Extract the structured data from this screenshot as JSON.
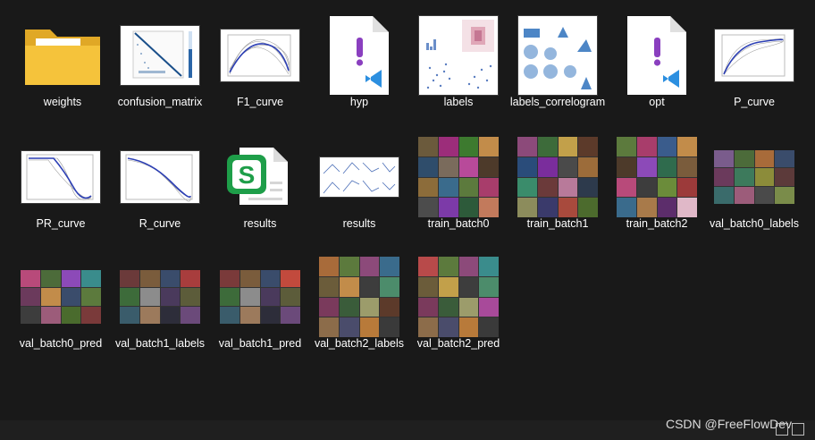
{
  "files": [
    {
      "name": "weights",
      "type": "folder"
    },
    {
      "name": "confusion_matrix",
      "type": "plot"
    },
    {
      "name": "F1_curve",
      "type": "plot"
    },
    {
      "name": "hyp",
      "type": "vscode"
    },
    {
      "name": "labels",
      "type": "plot"
    },
    {
      "name": "labels_correlogram",
      "type": "plot"
    },
    {
      "name": "opt",
      "type": "vscode"
    },
    {
      "name": "P_curve",
      "type": "plot"
    },
    {
      "name": "PR_curve",
      "type": "plot"
    },
    {
      "name": "R_curve",
      "type": "plot"
    },
    {
      "name": "results",
      "type": "sheet"
    },
    {
      "name": "results",
      "type": "plot"
    },
    {
      "name": "train_batch0",
      "type": "mosaic"
    },
    {
      "name": "train_batch1",
      "type": "mosaic"
    },
    {
      "name": "train_batch2",
      "type": "mosaic"
    },
    {
      "name": "val_batch0_labels",
      "type": "mosaic"
    },
    {
      "name": "val_batch0_pred",
      "type": "mosaic"
    },
    {
      "name": "val_batch1_labels",
      "type": "mosaic"
    },
    {
      "name": "val_batch1_pred",
      "type": "mosaic"
    },
    {
      "name": "val_batch2_labels",
      "type": "mosaic"
    },
    {
      "name": "val_batch2_pred",
      "type": "mosaic"
    }
  ],
  "watermark": "CSDN @FreeFlowDev",
  "colors": {
    "background": "#191919",
    "text": "#ffffff",
    "folder": "#f5c33b",
    "vscode": "#2c8fe0",
    "sheet": "#1e9e49"
  }
}
